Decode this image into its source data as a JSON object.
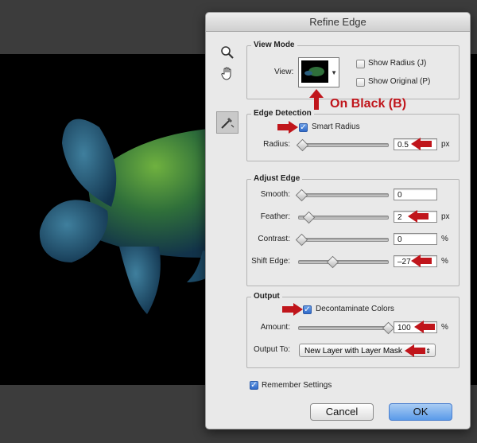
{
  "dialog": {
    "title": "Refine Edge"
  },
  "view_mode": {
    "legend": "View Mode",
    "view_label": "View:",
    "show_radius": {
      "label": "Show Radius (J)",
      "checked": false
    },
    "show_original": {
      "label": "Show Original (P)",
      "checked": false
    },
    "callout": "On Black (B)"
  },
  "edge_detection": {
    "legend": "Edge Detection",
    "smart_radius": {
      "label": "Smart Radius",
      "checked": true
    },
    "radius": {
      "label": "Radius:",
      "value": "0.5",
      "unit": "px"
    }
  },
  "adjust_edge": {
    "legend": "Adjust Edge",
    "smooth": {
      "label": "Smooth:",
      "value": "0",
      "unit": ""
    },
    "feather": {
      "label": "Feather:",
      "value": "2",
      "unit": "px"
    },
    "contrast": {
      "label": "Contrast:",
      "value": "0",
      "unit": "%"
    },
    "shift_edge": {
      "label": "Shift Edge:",
      "value": "–27",
      "unit": "%"
    }
  },
  "output": {
    "legend": "Output",
    "decontaminate": {
      "label": "Decontaminate Colors",
      "checked": true
    },
    "amount": {
      "label": "Amount:",
      "value": "100",
      "unit": "%"
    },
    "output_to": {
      "label": "Output To:",
      "selected": "New Layer with Layer Mask"
    }
  },
  "remember": {
    "label": "Remember Settings",
    "checked": true
  },
  "buttons": {
    "cancel": "Cancel",
    "ok": "OK"
  },
  "tools": [
    "zoom-tool-icon",
    "hand-tool-icon",
    "refine-radius-tool-icon"
  ],
  "colors": {
    "annotation_red": "#c0151b",
    "turtle_shell": "#2f6f3a",
    "ok_button": "#5a9ae9"
  }
}
